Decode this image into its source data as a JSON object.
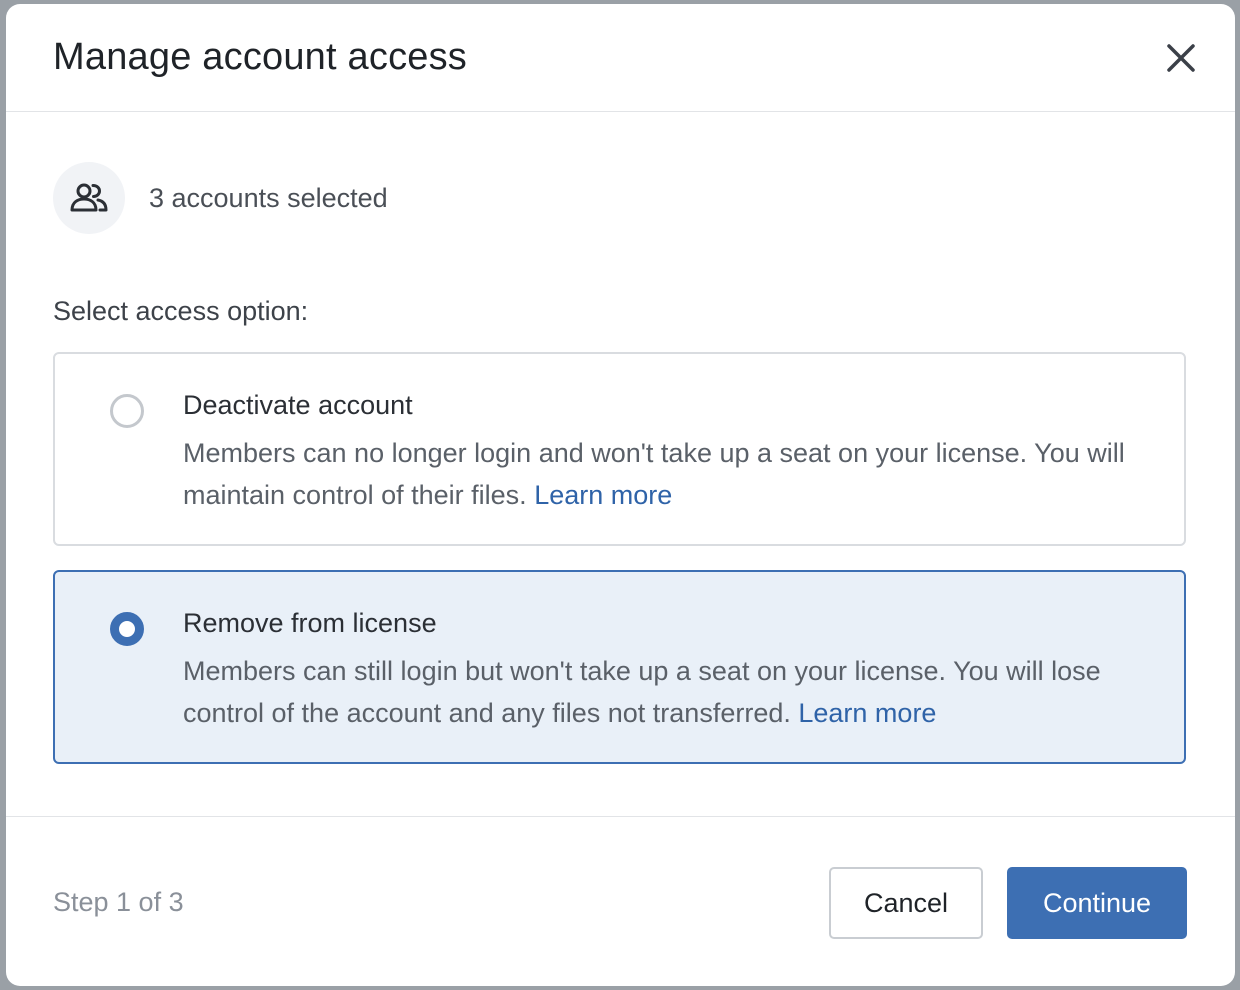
{
  "dialog": {
    "title": "Manage account access",
    "close_icon": "close-icon"
  },
  "summary": {
    "icon": "users-icon",
    "text": "3 accounts selected"
  },
  "options_label": "Select access option:",
  "options": [
    {
      "title": "Deactivate account",
      "description": "Members can no longer login and won't take up a seat on your license. You will maintain control of their files.",
      "link": "Learn more",
      "selected": false
    },
    {
      "title": "Remove from license",
      "description": "Members can still login but won't take up a seat on your license. You will lose control of the account and any files not transferred.",
      "link": "Learn more",
      "selected": true
    }
  ],
  "footer": {
    "step": "Step 1 of 3",
    "cancel_label": "Cancel",
    "continue_label": "Continue"
  },
  "colors": {
    "accent": "#3d6fb3",
    "selected_bg": "#e9f0f8",
    "link": "#2f63a8"
  }
}
